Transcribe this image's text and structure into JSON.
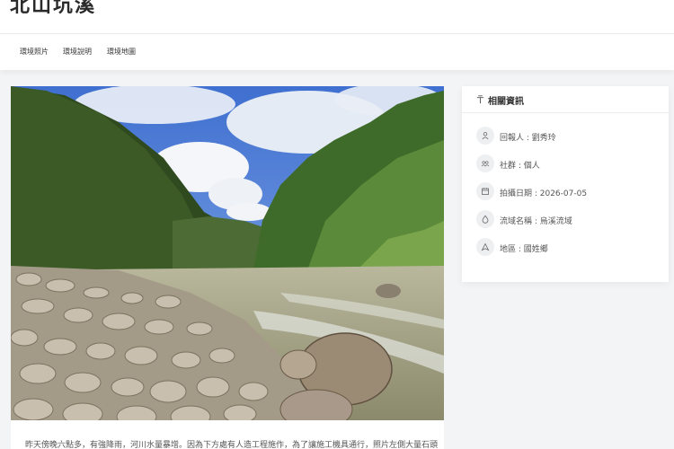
{
  "page": {
    "title": "北山坑溪"
  },
  "tabs": [
    {
      "label": "環境照片"
    },
    {
      "label": "環境說明"
    },
    {
      "label": "環境地圖"
    }
  ],
  "photo": {
    "description": "昨天傍晚六點多，有強降雨，河川水量暴增。因為下方處有人造工程施作，為了讓施工機具通行，照片左側大量石頭"
  },
  "info": {
    "title": "相關資訊",
    "rows": [
      {
        "icon": "person-icon",
        "text": "回報人 : 劉秀玲"
      },
      {
        "icon": "group-icon",
        "text": "社群 : 個人"
      },
      {
        "icon": "calendar-icon",
        "text": "拍攝日期 : 2026-07-05"
      },
      {
        "icon": "water-drop-icon",
        "text": "流域名稱 : 烏溪流域"
      },
      {
        "icon": "location-icon",
        "text": "地區 : 國姓鄉"
      }
    ]
  }
}
